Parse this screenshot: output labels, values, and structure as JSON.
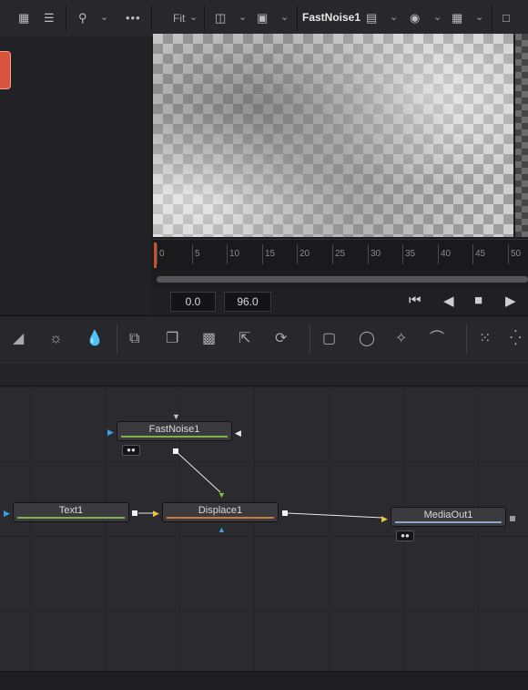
{
  "top_toolbar": {
    "fit_label": "Fit",
    "viewer_node": "FastNoise1",
    "icons": [
      "grid-view-icon",
      "list-view-icon",
      "search-icon",
      "more-icon",
      "split-view-icon",
      "layout-icon",
      "lut-icon",
      "color-channel-icon",
      "grid-overlay-icon",
      "roi-icon"
    ]
  },
  "timeline": {
    "ruler_marks": [
      "0",
      "5",
      "10",
      "15",
      "20",
      "25",
      "30",
      "35",
      "40",
      "45",
      "50"
    ],
    "start_time": "0.0",
    "end_time": "96.0",
    "transport_icons": [
      "go-to-start-icon",
      "play-reverse-icon",
      "stop-icon",
      "play-forward-icon"
    ]
  },
  "toolbar": {
    "tools": [
      "background-icon",
      "brightness-contrast-icon",
      "color-corrector-icon",
      "merge-icon",
      "paint-icon",
      "matte-icon",
      "resize-icon",
      "transform-icon",
      "rectangle-mask-icon",
      "ellipse-mask-icon",
      "polygon-mask-icon",
      "bspline-mask-icon",
      "particle-emitter-icon",
      "particle-render-icon"
    ]
  },
  "nodes": {
    "fastnoise": {
      "label": "FastNoise1",
      "color": "#7fb24a"
    },
    "text": {
      "label": "Text1",
      "color": "#7fb24a"
    },
    "displace": {
      "label": "Displace1",
      "color": "#c97a3a"
    },
    "mediaout": {
      "label": "MediaOut1",
      "color": "#8fa8c8"
    }
  },
  "colors": {
    "accent_playhead": "#c8502f",
    "input_arrow_yellow": "#e8c43a",
    "input_arrow_green": "#7fc43a",
    "input_arrow_blue": "#3aa0e8"
  }
}
